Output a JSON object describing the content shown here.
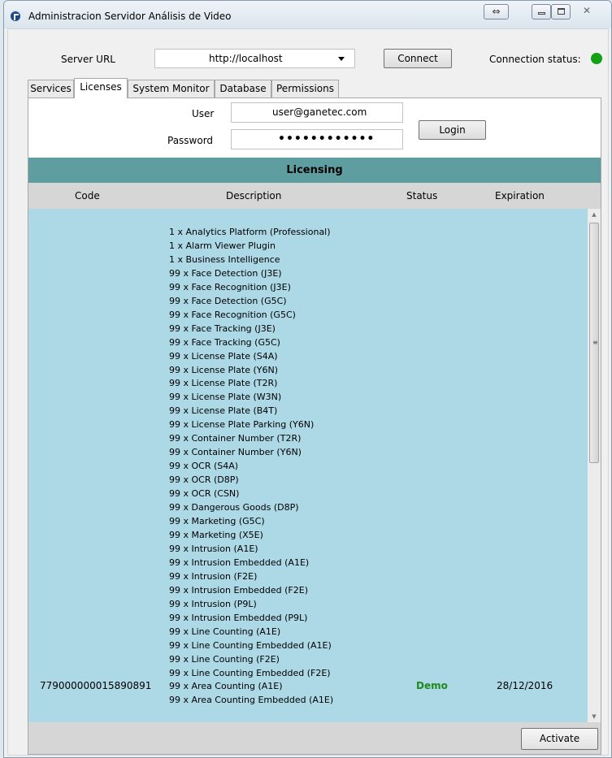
{
  "window": {
    "title": "Administracion Servidor Análisis de Video",
    "close_glyph": "✕"
  },
  "connection": {
    "server_url_label": "Server URL",
    "server_url_value": "http://localhost",
    "connect_label": "Connect",
    "status_label": "Connection status:",
    "status_color": "#14a014"
  },
  "tabs": [
    "Services",
    "Licenses",
    "System Monitor",
    "Database",
    "Permissions"
  ],
  "login": {
    "user_label": "User",
    "user_value": "user@ganetec.com",
    "password_label": "Password",
    "password_mask": "••••••••••••",
    "login_label": "Login"
  },
  "licensing": {
    "header": "Licensing",
    "columns": [
      "Code",
      "Description",
      "Status",
      "Expiration"
    ],
    "row": {
      "code": "779000000015890891",
      "status": "Demo",
      "expiration": "28/12/2016",
      "description_lines": [
        "1  x  Analytics Platform (Professional)",
        "1  x  Alarm Viewer Plugin",
        "1  x  Business Intelligence",
        "99  x  Face Detection (J3E)",
        "99  x  Face Recognition (J3E)",
        "99  x  Face Detection (G5C)",
        "99  x  Face Recognition (G5C)",
        "99  x  Face Tracking (J3E)",
        "99  x  Face Tracking (G5C)",
        "99  x  License Plate (S4A)",
        "99  x  License Plate (Y6N)",
        "99  x  License Plate (T2R)",
        "99  x  License Plate (W3N)",
        "99  x  License Plate (B4T)",
        "99  x  License Plate Parking (Y6N)",
        "99  x  Container Number (T2R)",
        "99  x  Container Number (Y6N)",
        "99  x  OCR (S4A)",
        "99  x  OCR (D8P)",
        "99  x  OCR (CSN)",
        "99  x  Dangerous Goods (D8P)",
        "99  x  Marketing (G5C)",
        "99  x  Marketing (X5E)",
        "99  x  Intrusion (A1E)",
        "99  x  Intrusion Embedded (A1E)",
        "99  x  Intrusion (F2E)",
        "99  x  Intrusion Embedded (F2E)",
        "99  x  Intrusion (P9L)",
        "99  x  Intrusion Embedded (P9L)",
        "99  x  Line Counting (A1E)",
        "99  x  Line Counting Embedded (A1E)",
        "99  x  Line Counting (F2E)",
        "99  x  Line Counting Embedded (F2E)",
        "99  x  Area Counting (A1E)",
        "99  x  Area Counting Embedded (A1E)"
      ]
    },
    "activate_label": "Activate"
  }
}
